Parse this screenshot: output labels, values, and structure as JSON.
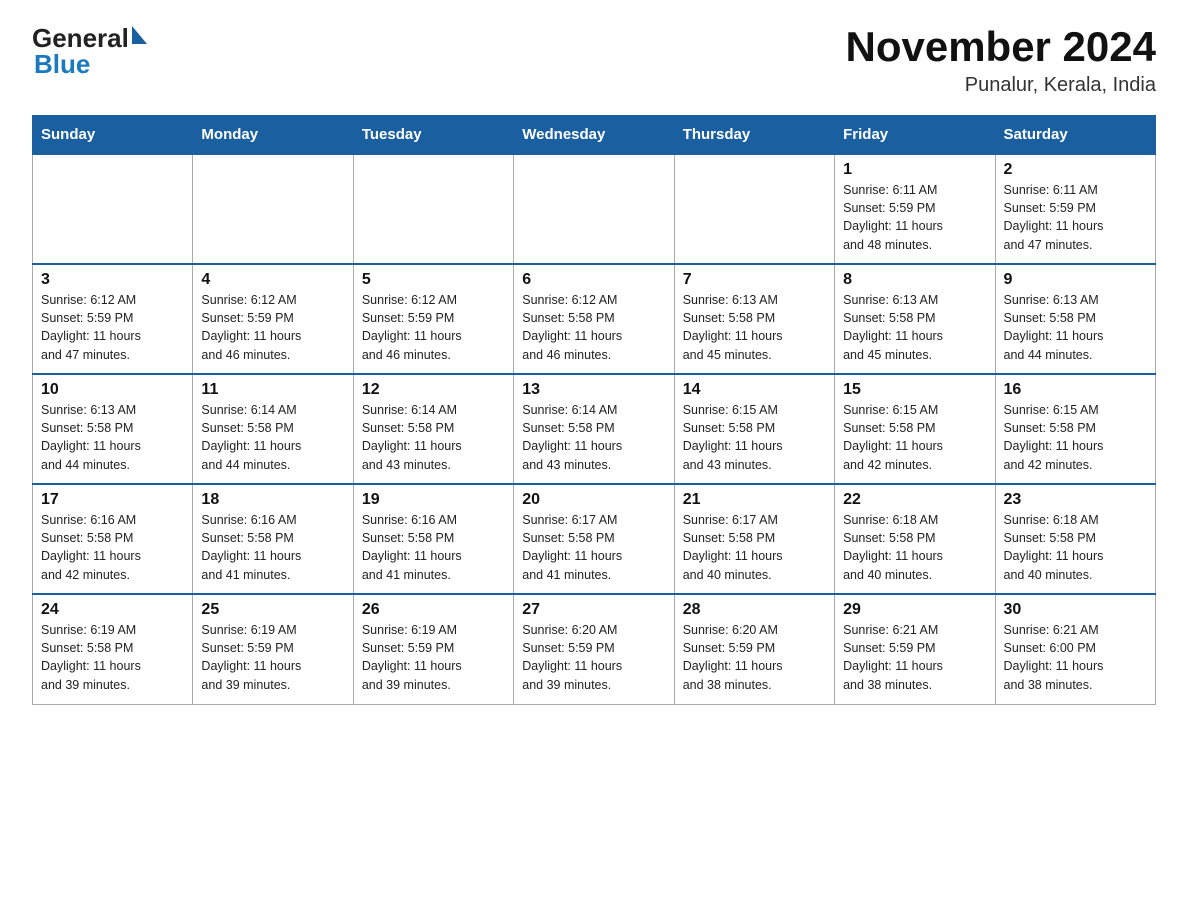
{
  "header": {
    "logo_general": "General",
    "logo_blue": "Blue",
    "title": "November 2024",
    "subtitle": "Punalur, Kerala, India"
  },
  "weekdays": [
    "Sunday",
    "Monday",
    "Tuesday",
    "Wednesday",
    "Thursday",
    "Friday",
    "Saturday"
  ],
  "weeks": [
    [
      {
        "day": "",
        "info": ""
      },
      {
        "day": "",
        "info": ""
      },
      {
        "day": "",
        "info": ""
      },
      {
        "day": "",
        "info": ""
      },
      {
        "day": "",
        "info": ""
      },
      {
        "day": "1",
        "info": "Sunrise: 6:11 AM\nSunset: 5:59 PM\nDaylight: 11 hours\nand 48 minutes."
      },
      {
        "day": "2",
        "info": "Sunrise: 6:11 AM\nSunset: 5:59 PM\nDaylight: 11 hours\nand 47 minutes."
      }
    ],
    [
      {
        "day": "3",
        "info": "Sunrise: 6:12 AM\nSunset: 5:59 PM\nDaylight: 11 hours\nand 47 minutes."
      },
      {
        "day": "4",
        "info": "Sunrise: 6:12 AM\nSunset: 5:59 PM\nDaylight: 11 hours\nand 46 minutes."
      },
      {
        "day": "5",
        "info": "Sunrise: 6:12 AM\nSunset: 5:59 PM\nDaylight: 11 hours\nand 46 minutes."
      },
      {
        "day": "6",
        "info": "Sunrise: 6:12 AM\nSunset: 5:58 PM\nDaylight: 11 hours\nand 46 minutes."
      },
      {
        "day": "7",
        "info": "Sunrise: 6:13 AM\nSunset: 5:58 PM\nDaylight: 11 hours\nand 45 minutes."
      },
      {
        "day": "8",
        "info": "Sunrise: 6:13 AM\nSunset: 5:58 PM\nDaylight: 11 hours\nand 45 minutes."
      },
      {
        "day": "9",
        "info": "Sunrise: 6:13 AM\nSunset: 5:58 PM\nDaylight: 11 hours\nand 44 minutes."
      }
    ],
    [
      {
        "day": "10",
        "info": "Sunrise: 6:13 AM\nSunset: 5:58 PM\nDaylight: 11 hours\nand 44 minutes."
      },
      {
        "day": "11",
        "info": "Sunrise: 6:14 AM\nSunset: 5:58 PM\nDaylight: 11 hours\nand 44 minutes."
      },
      {
        "day": "12",
        "info": "Sunrise: 6:14 AM\nSunset: 5:58 PM\nDaylight: 11 hours\nand 43 minutes."
      },
      {
        "day": "13",
        "info": "Sunrise: 6:14 AM\nSunset: 5:58 PM\nDaylight: 11 hours\nand 43 minutes."
      },
      {
        "day": "14",
        "info": "Sunrise: 6:15 AM\nSunset: 5:58 PM\nDaylight: 11 hours\nand 43 minutes."
      },
      {
        "day": "15",
        "info": "Sunrise: 6:15 AM\nSunset: 5:58 PM\nDaylight: 11 hours\nand 42 minutes."
      },
      {
        "day": "16",
        "info": "Sunrise: 6:15 AM\nSunset: 5:58 PM\nDaylight: 11 hours\nand 42 minutes."
      }
    ],
    [
      {
        "day": "17",
        "info": "Sunrise: 6:16 AM\nSunset: 5:58 PM\nDaylight: 11 hours\nand 42 minutes."
      },
      {
        "day": "18",
        "info": "Sunrise: 6:16 AM\nSunset: 5:58 PM\nDaylight: 11 hours\nand 41 minutes."
      },
      {
        "day": "19",
        "info": "Sunrise: 6:16 AM\nSunset: 5:58 PM\nDaylight: 11 hours\nand 41 minutes."
      },
      {
        "day": "20",
        "info": "Sunrise: 6:17 AM\nSunset: 5:58 PM\nDaylight: 11 hours\nand 41 minutes."
      },
      {
        "day": "21",
        "info": "Sunrise: 6:17 AM\nSunset: 5:58 PM\nDaylight: 11 hours\nand 40 minutes."
      },
      {
        "day": "22",
        "info": "Sunrise: 6:18 AM\nSunset: 5:58 PM\nDaylight: 11 hours\nand 40 minutes."
      },
      {
        "day": "23",
        "info": "Sunrise: 6:18 AM\nSunset: 5:58 PM\nDaylight: 11 hours\nand 40 minutes."
      }
    ],
    [
      {
        "day": "24",
        "info": "Sunrise: 6:19 AM\nSunset: 5:58 PM\nDaylight: 11 hours\nand 39 minutes."
      },
      {
        "day": "25",
        "info": "Sunrise: 6:19 AM\nSunset: 5:59 PM\nDaylight: 11 hours\nand 39 minutes."
      },
      {
        "day": "26",
        "info": "Sunrise: 6:19 AM\nSunset: 5:59 PM\nDaylight: 11 hours\nand 39 minutes."
      },
      {
        "day": "27",
        "info": "Sunrise: 6:20 AM\nSunset: 5:59 PM\nDaylight: 11 hours\nand 39 minutes."
      },
      {
        "day": "28",
        "info": "Sunrise: 6:20 AM\nSunset: 5:59 PM\nDaylight: 11 hours\nand 38 minutes."
      },
      {
        "day": "29",
        "info": "Sunrise: 6:21 AM\nSunset: 5:59 PM\nDaylight: 11 hours\nand 38 minutes."
      },
      {
        "day": "30",
        "info": "Sunrise: 6:21 AM\nSunset: 6:00 PM\nDaylight: 11 hours\nand 38 minutes."
      }
    ]
  ]
}
